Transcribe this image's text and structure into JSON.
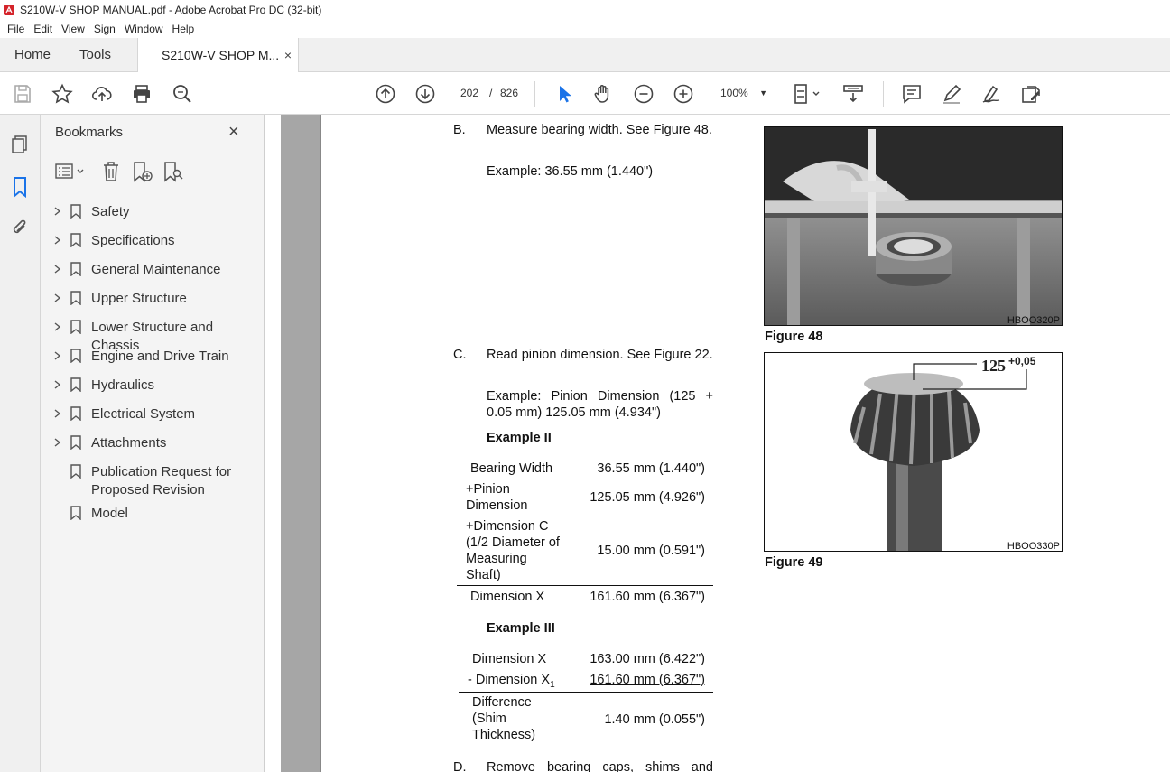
{
  "window": {
    "title": "S210W-V SHOP MANUAL.pdf - Adobe Acrobat Pro DC (32-bit)"
  },
  "menu": [
    "File",
    "Edit",
    "View",
    "Sign",
    "Window",
    "Help"
  ],
  "tabs": {
    "home": "Home",
    "tools": "Tools",
    "document": "S210W-V SHOP M...",
    "close": "×"
  },
  "toolbar": {
    "page_current": "202",
    "page_sep": "/",
    "page_total": "826",
    "zoom": "100%",
    "icons": [
      "save-icon",
      "star-icon",
      "upload-icon",
      "print-icon",
      "search-icon",
      "prev-page-icon",
      "next-page-icon",
      "select-cursor-icon",
      "hand-icon",
      "zoom-out-icon",
      "zoom-in-icon",
      "page-fit-icon",
      "scroll-mode-icon",
      "comment-icon",
      "highlight-icon",
      "sign-icon",
      "edit-icon"
    ],
    "accent": "#1a73e8"
  },
  "bookmarks": {
    "title": "Bookmarks",
    "close": "×",
    "items": [
      {
        "label": "Safety",
        "expandable": true
      },
      {
        "label": "Specifications",
        "expandable": true
      },
      {
        "label": "General Maintenance",
        "expandable": true
      },
      {
        "label": "Upper Structure",
        "expandable": true
      },
      {
        "label": "Lower Structure and Chassis",
        "expandable": true
      },
      {
        "label": "Engine and Drive Train",
        "expandable": true
      },
      {
        "label": "Hydraulics",
        "expandable": true
      },
      {
        "label": "Electrical System",
        "expandable": true
      },
      {
        "label": "Attachments",
        "expandable": true
      },
      {
        "label": "Publication Request for Proposed Revision",
        "expandable": false
      },
      {
        "label": "Model",
        "expandable": false
      }
    ]
  },
  "document": {
    "stepB": {
      "letter": "B.",
      "text": "Measure bearing width. See Figure 48.",
      "example": "Example: 36.55 mm (1.440\")"
    },
    "stepC": {
      "letter": "C.",
      "text": "Read pinion dimension. See Figure 22.",
      "example": "Example: Pinion Dimension (125 + 0.05 mm) 125.05 mm (4.934\")"
    },
    "example2": {
      "heading": "Example II",
      "rows": [
        {
          "label": "Bearing Width",
          "value": "36.55 mm (1.440\")"
        },
        {
          "label": "+Pinion Dimension",
          "value": "125.05 mm (4.926\")"
        },
        {
          "label": "+Dimension C (1/2 Diameter of Measuring Shaft)",
          "value": "15.00 mm (0.591\")"
        },
        {
          "label": "Dimension X",
          "value": "161.60 mm (6.367\")"
        }
      ]
    },
    "example3": {
      "heading": "Example III",
      "rows": [
        {
          "label": "Dimension X",
          "value": "163.00 mm (6.422\")"
        },
        {
          "label": "- Dimension X",
          "subscript": "1",
          "value": "161.60 mm (6.367\")"
        },
        {
          "label": "Difference (Shim Thickness)",
          "value": "1.40 mm (0.055\")"
        }
      ]
    },
    "stepD": {
      "letter": "D.",
      "text": "Remove bearing caps, shims and"
    },
    "figure48": {
      "caption": "Figure 48",
      "code": "HBOO320P"
    },
    "figure49": {
      "caption": "Figure 49",
      "code": "HBOO330P",
      "callout_main": "125",
      "callout_tol": "+0,05"
    }
  }
}
